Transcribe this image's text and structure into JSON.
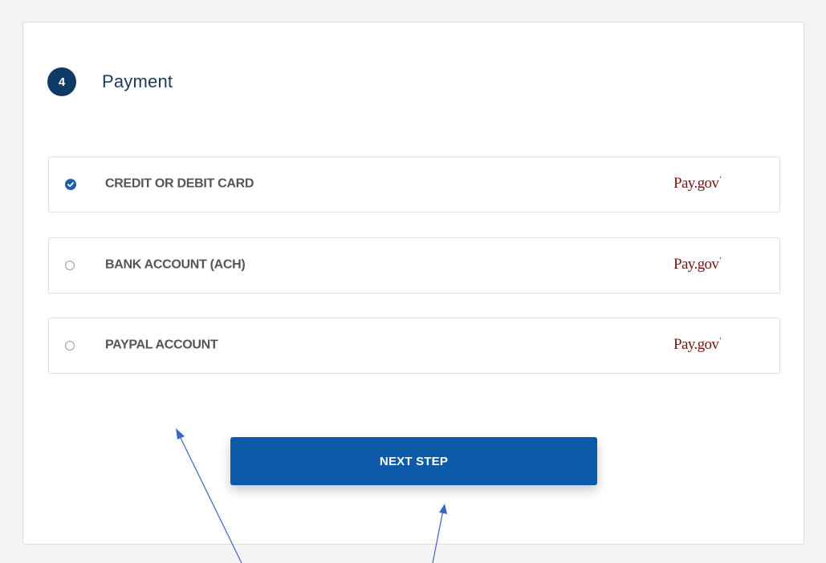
{
  "step": {
    "number": "4",
    "title": "Payment"
  },
  "payment_options": [
    {
      "label": "CREDIT OR DEBIT CARD",
      "selected": true,
      "logo_text": "Pay.gov"
    },
    {
      "label": "BANK ACCOUNT (ACH)",
      "selected": false,
      "logo_text": "Pay.gov"
    },
    {
      "label": "PAYPAL ACCOUNT",
      "selected": false,
      "logo_text": "Pay.gov"
    }
  ],
  "next_button": {
    "label": "NEXT STEP"
  },
  "colors": {
    "primary": "#0d5ba8",
    "step_badge": "#0f3a66",
    "logo": "#7a1414",
    "annotation_arrow": "#3b64c4"
  },
  "icons": {
    "selected_radio": "check-circle-icon",
    "unselected_radio": "radio-empty-icon",
    "annotation": "arrow-icon"
  }
}
